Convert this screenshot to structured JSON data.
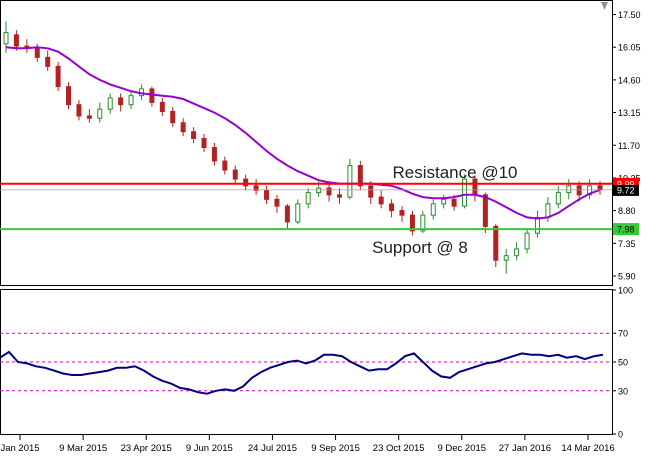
{
  "chart_data": [
    {
      "type": "candlestick",
      "panel": "price",
      "ylim": [
        5.5,
        18.1
      ],
      "y_ticks": [
        "17.50",
        "16.05",
        "14.60",
        "13.15",
        "11.70",
        "10.25",
        "8.80",
        "7.35",
        "5.90"
      ],
      "current_price_labels": [
        "9.72"
      ],
      "colors": {
        "bull": "#2e8b2e",
        "bear": "#b22222",
        "ma": "#9900cc",
        "resistance": "#ff0000",
        "support": "#33cc33"
      },
      "series": [
        {
          "name": "Moving average",
          "values": [
            16.05,
            16.0,
            16.0,
            16.05,
            16.0,
            15.85,
            15.55,
            15.2,
            14.85,
            14.6,
            14.4,
            14.25,
            14.1,
            14.0,
            13.95,
            13.9,
            13.85,
            13.75,
            13.55,
            13.35,
            13.15,
            12.9,
            12.6,
            12.25,
            11.85,
            11.45,
            11.1,
            10.8,
            10.55,
            10.35,
            10.15,
            10.05,
            10.0,
            10.0,
            10.0,
            10.0,
            9.95,
            9.9,
            9.75,
            9.55,
            9.4,
            9.35,
            9.35,
            9.4,
            9.5,
            9.5,
            9.4,
            9.2,
            8.95,
            8.7,
            8.5,
            8.45,
            8.5,
            8.7,
            9.0,
            9.3,
            9.55,
            9.72
          ]
        }
      ],
      "candles": [
        {
          "o": 16.2,
          "c": 16.7,
          "h": 17.2,
          "l": 15.8
        },
        {
          "o": 16.6,
          "c": 16.1,
          "h": 16.8,
          "l": 15.9
        },
        {
          "o": 16.1,
          "c": 16.0,
          "h": 16.4,
          "l": 15.8
        },
        {
          "o": 16.0,
          "c": 15.6,
          "h": 16.2,
          "l": 15.4
        },
        {
          "o": 15.6,
          "c": 15.2,
          "h": 15.9,
          "l": 15.0
        },
        {
          "o": 15.2,
          "c": 14.3,
          "h": 15.4,
          "l": 14.1
        },
        {
          "o": 14.3,
          "c": 13.5,
          "h": 14.5,
          "l": 13.3
        },
        {
          "o": 13.5,
          "c": 13.0,
          "h": 13.7,
          "l": 12.8
        },
        {
          "o": 13.0,
          "c": 12.9,
          "h": 13.3,
          "l": 12.7
        },
        {
          "o": 12.9,
          "c": 13.3,
          "h": 13.6,
          "l": 12.7
        },
        {
          "o": 13.3,
          "c": 13.8,
          "h": 14.0,
          "l": 13.1
        },
        {
          "o": 13.8,
          "c": 13.5,
          "h": 14.0,
          "l": 13.2
        },
        {
          "o": 13.5,
          "c": 13.9,
          "h": 14.1,
          "l": 13.3
        },
        {
          "o": 13.9,
          "c": 14.2,
          "h": 14.4,
          "l": 13.7
        },
        {
          "o": 14.2,
          "c": 13.6,
          "h": 14.3,
          "l": 13.4
        },
        {
          "o": 13.6,
          "c": 13.2,
          "h": 13.8,
          "l": 13.0
        },
        {
          "o": 13.2,
          "c": 12.7,
          "h": 13.4,
          "l": 12.5
        },
        {
          "o": 12.7,
          "c": 12.3,
          "h": 12.9,
          "l": 12.1
        },
        {
          "o": 12.3,
          "c": 12.0,
          "h": 12.5,
          "l": 11.8
        },
        {
          "o": 12.0,
          "c": 11.6,
          "h": 12.2,
          "l": 11.4
        },
        {
          "o": 11.6,
          "c": 11.0,
          "h": 11.8,
          "l": 10.8
        },
        {
          "o": 11.0,
          "c": 10.6,
          "h": 11.2,
          "l": 10.4
        },
        {
          "o": 10.6,
          "c": 10.2,
          "h": 10.8,
          "l": 10.0
        },
        {
          "o": 10.2,
          "c": 9.9,
          "h": 10.4,
          "l": 9.7
        },
        {
          "o": 9.9,
          "c": 9.7,
          "h": 10.2,
          "l": 9.5
        },
        {
          "o": 9.7,
          "c": 9.3,
          "h": 9.9,
          "l": 9.1
        },
        {
          "o": 9.3,
          "c": 9.0,
          "h": 9.5,
          "l": 8.7
        },
        {
          "o": 9.0,
          "c": 8.3,
          "h": 9.1,
          "l": 8.0
        },
        {
          "o": 8.3,
          "c": 9.1,
          "h": 9.3,
          "l": 8.2
        },
        {
          "o": 9.1,
          "c": 9.6,
          "h": 9.8,
          "l": 8.9
        },
        {
          "o": 9.6,
          "c": 9.8,
          "h": 10.1,
          "l": 9.4
        },
        {
          "o": 9.8,
          "c": 9.5,
          "h": 10.0,
          "l": 9.2
        },
        {
          "o": 9.5,
          "c": 9.4,
          "h": 9.8,
          "l": 9.1
        },
        {
          "o": 9.4,
          "c": 10.8,
          "h": 11.1,
          "l": 9.3
        },
        {
          "o": 10.8,
          "c": 9.9,
          "h": 11.0,
          "l": 9.7
        },
        {
          "o": 9.9,
          "c": 9.4,
          "h": 10.1,
          "l": 9.1
        },
        {
          "o": 9.4,
          "c": 9.1,
          "h": 9.7,
          "l": 8.9
        },
        {
          "o": 9.1,
          "c": 8.8,
          "h": 9.3,
          "l": 8.5
        },
        {
          "o": 8.8,
          "c": 8.6,
          "h": 9.0,
          "l": 8.3
        },
        {
          "o": 8.6,
          "c": 7.9,
          "h": 8.8,
          "l": 7.7
        },
        {
          "o": 7.9,
          "c": 8.6,
          "h": 8.8,
          "l": 7.8
        },
        {
          "o": 8.6,
          "c": 9.1,
          "h": 9.3,
          "l": 8.4
        },
        {
          "o": 9.1,
          "c": 9.3,
          "h": 9.5,
          "l": 8.9
        },
        {
          "o": 9.3,
          "c": 9.0,
          "h": 9.5,
          "l": 8.8
        },
        {
          "o": 9.0,
          "c": 10.2,
          "h": 10.4,
          "l": 8.9
        },
        {
          "o": 10.2,
          "c": 9.5,
          "h": 10.3,
          "l": 9.2
        },
        {
          "o": 9.5,
          "c": 8.1,
          "h": 9.6,
          "l": 7.8
        },
        {
          "o": 8.1,
          "c": 6.6,
          "h": 8.2,
          "l": 6.3
        },
        {
          "o": 6.6,
          "c": 6.8,
          "h": 7.1,
          "l": 6.0
        },
        {
          "o": 6.8,
          "c": 7.1,
          "h": 7.4,
          "l": 6.6
        },
        {
          "o": 7.1,
          "c": 7.8,
          "h": 8.0,
          "l": 6.9
        },
        {
          "o": 7.8,
          "c": 8.5,
          "h": 8.8,
          "l": 7.6
        },
        {
          "o": 8.5,
          "c": 9.1,
          "h": 9.4,
          "l": 8.3
        },
        {
          "o": 9.1,
          "c": 9.6,
          "h": 9.9,
          "l": 8.9
        },
        {
          "o": 9.6,
          "c": 9.9,
          "h": 10.2,
          "l": 9.3
        },
        {
          "o": 9.9,
          "c": 9.5,
          "h": 10.1,
          "l": 9.2
        },
        {
          "o": 9.5,
          "c": 9.9,
          "h": 10.2,
          "l": 9.3
        },
        {
          "o": 9.9,
          "c": 9.72,
          "h": 10.1,
          "l": 9.5
        }
      ],
      "levels": [
        {
          "name": "resistance",
          "value": 9.99,
          "label": "9.99",
          "annotation": "Resistance @10"
        },
        {
          "name": "support",
          "value": 7.98,
          "label": "7.98",
          "annotation": "Support @ 8"
        }
      ]
    },
    {
      "type": "line",
      "panel": "oscillator",
      "ylim": [
        0,
        100
      ],
      "y_ticks": [
        "100",
        "70",
        "50",
        "30",
        "0"
      ],
      "levels": [
        70,
        50,
        30
      ],
      "colors": {
        "line": "#000080",
        "levels": "#cc00cc"
      },
      "series": [
        {
          "name": "Oscillator",
          "values": [
            53,
            57,
            50,
            49,
            47,
            46,
            44,
            42,
            41,
            41,
            42,
            43,
            44,
            46,
            46,
            47,
            44,
            40,
            37,
            35,
            32,
            31,
            29,
            28,
            30,
            31,
            30,
            33,
            39,
            43,
            46,
            48,
            50,
            51,
            49,
            51,
            55,
            55,
            54,
            50,
            47,
            44,
            45,
            45,
            49,
            54,
            56,
            50,
            44,
            40,
            39,
            43,
            45,
            47,
            49,
            50,
            52,
            54,
            56,
            55,
            55,
            54,
            55,
            53,
            54,
            52,
            54,
            55
          ]
        }
      ]
    }
  ],
  "x_axis": {
    "labels": [
      "Jan 2015",
      "9 Mar 2015",
      "23 Apr 2015",
      "9 Jun 2015",
      "24 Jul 2015",
      "9 Sep 2015",
      "23 Oct 2015",
      "9 Dec 2015",
      "27 Jan 2016",
      "14 Mar 2016"
    ]
  },
  "ui": {
    "scroll_arrow": "scroll-up-arrow-icon"
  }
}
